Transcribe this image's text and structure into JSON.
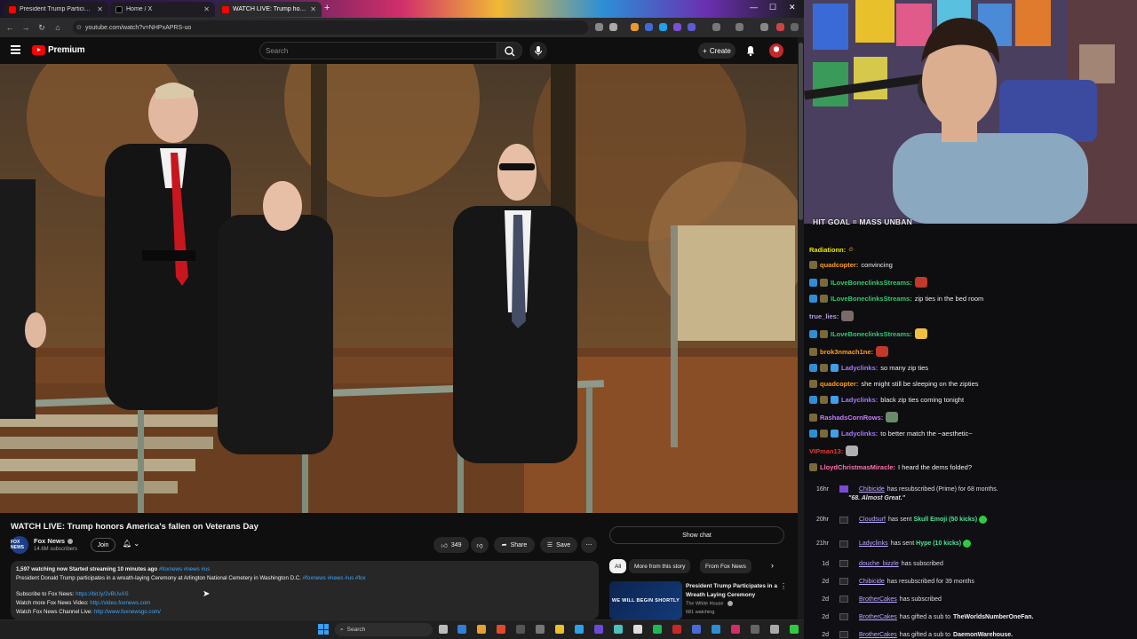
{
  "browser": {
    "tabs": [
      {
        "title": "President Trump Participates in",
        "favicon_color": "#ff0000",
        "active": false
      },
      {
        "title": "Home / X",
        "favicon_color": "#000000",
        "active": false
      },
      {
        "title": "WATCH LIVE: Trump honors",
        "favicon_color": "#ff0000",
        "active": true
      }
    ],
    "url": "youtube.com/watch?v=NHPxAPRS-uo"
  },
  "youtube": {
    "logo_text": "Premium",
    "search_placeholder": "Search",
    "create_label": "Create",
    "video": {
      "title": "WATCH LIVE: Trump honors America's fallen on Veterans Day",
      "channel": "Fox News",
      "channel_avatar_text": "FOX NEWS",
      "subscribers": "14.6M subscribers",
      "join_label": "Join",
      "likes": "349",
      "share_label": "Share",
      "save_label": "Save",
      "stats": "1,597 watching now  Started streaming 10 minutes ago",
      "stat_tags": "#foxnews #news #us",
      "description": "President Donald Trump participates in a wreath-laying Ceremony at Arlington National Cemetery in Washington D.C.",
      "description_tags": "#foxnews #news #us #fox",
      "links": [
        {
          "label": "Subscribe to Fox News:",
          "url": "https://bit.ly/2vBUvAS"
        },
        {
          "label": "Watch more Fox News Video:",
          "url": "http://video.foxnews.com"
        },
        {
          "label": "Watch Fox News Channel Live:",
          "url": "http://www.foxnewsgo.com/"
        }
      ]
    },
    "show_chat_label": "Show chat",
    "chips": [
      "All",
      "More from this story",
      "From Fox News"
    ],
    "recommended": {
      "thumb_text": "WE WILL BEGIN SHORTLY",
      "title": "President Trump Participates in a Wreath Laying Ceremony",
      "channel": "The White House",
      "views": "681 watching"
    }
  },
  "taskbar": {
    "search_placeholder": "Search"
  },
  "stream": {
    "goal_text": "HIT GOAL = MASS UNBAN",
    "chat": [
      {
        "user": "Radiationn:",
        "message": "",
        "color": "#e6e600",
        "emote": "#f0a030"
      },
      {
        "user": "quadcopter:",
        "message": "convincing",
        "color": "#ff9f1a"
      },
      {
        "user": "ILoveBoneclinksStreams:",
        "message": "",
        "color": "#2ecc71",
        "emote": "#c0392b"
      },
      {
        "user": "ILoveBoneclinksStreams:",
        "message": "zip ties in the bed room",
        "color": "#2ecc71"
      },
      {
        "user": "true_lies:",
        "message": "",
        "color": "#b39ddb",
        "emote": "#7a6a6a"
      },
      {
        "user": "ILoveBoneclinksStreams:",
        "message": "",
        "color": "#2ecc71",
        "emote": "#f0c040"
      },
      {
        "user": "brok3nmach1ne:",
        "message": "",
        "color": "#ff9f1a",
        "emote": "#c0392b"
      },
      {
        "user": "Ladyclinks:",
        "message": "so many zip ties",
        "color": "#a678ff"
      },
      {
        "user": "quadcopter:",
        "message": "she might still be sleeping on the zipties",
        "color": "#ff9f1a"
      },
      {
        "user": "Ladyclinks:",
        "message": "black zip ties coming tonight",
        "color": "#a678ff"
      },
      {
        "user": "RashadsCornRows:",
        "message": "",
        "color": "#c77dff",
        "emote": "#6a8a6a"
      },
      {
        "user": "Ladyclinks:",
        "message": "to better match the ~aesthetic~",
        "color": "#a678ff"
      },
      {
        "user": "VIPman13:",
        "message": "",
        "color": "#e53935",
        "emote": "#b0b0b0"
      },
      {
        "user": "LloydChristmasMiracle:",
        "message": "I heard the dems folded?",
        "color": "#ff6fae"
      }
    ],
    "activity": [
      {
        "time": "16hr",
        "name": "Chibicide",
        "text": "has resubscribed (Prime) for 68 months.",
        "quote": "\"68. Almost Great.\""
      },
      {
        "time": "20hr",
        "name": "Cloudsurf",
        "text": "has sent",
        "highlight": "Skull Emoji (50 kicks)"
      },
      {
        "time": "21hr",
        "name": "Ladyclinks",
        "text": "has sent",
        "highlight": "Hype (10 kicks)"
      },
      {
        "time": "1d",
        "name": "douche_bizzle",
        "text": "has subscribed"
      },
      {
        "time": "2d",
        "name": "Chibicide",
        "text": "has resubscribed for 39 months"
      },
      {
        "time": "2d",
        "name": "BrotherCakes",
        "text": "has subscribed"
      },
      {
        "time": "2d",
        "name": "BrotherCakes",
        "text": "has gifted a sub to",
        "target": "TheWorldsNumberOneFan."
      },
      {
        "time": "2d",
        "name": "BrotherCakes",
        "text": "has gifted a sub to",
        "target": "DaemonWarehouse."
      }
    ]
  }
}
